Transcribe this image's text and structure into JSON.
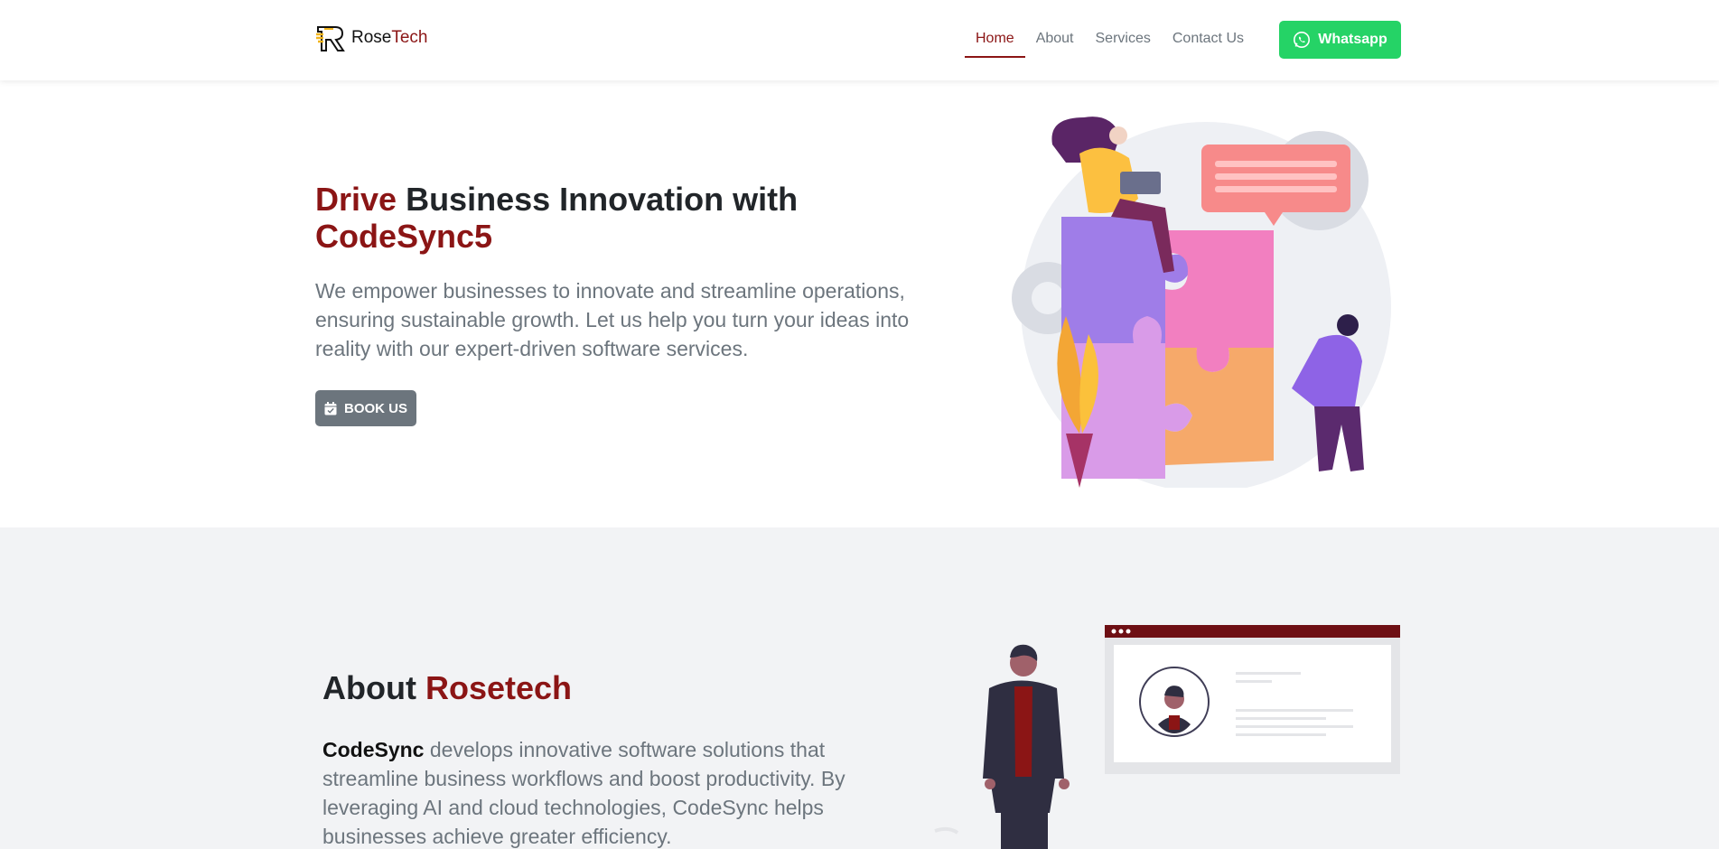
{
  "navbar": {
    "brand": {
      "name_part1": "Rose",
      "name_part2": "Tech",
      "logo_icon": "rosetech-logo-icon"
    },
    "links": [
      {
        "label": "Home",
        "active": true
      },
      {
        "label": "About",
        "active": false
      },
      {
        "label": "Services",
        "active": false
      },
      {
        "label": "Contact Us",
        "active": false
      }
    ],
    "whatsapp": {
      "label": "Whatsapp",
      "icon": "whatsapp-icon"
    }
  },
  "hero": {
    "title_accent": "Drive",
    "title_rest": " Business Innovation with",
    "title_line2": "CodeSync5",
    "description": "We empower businesses to innovate and streamline operations, ensuring sustainable growth. Let us help you turn your ideas into reality with our expert-driven software services.",
    "book_button": {
      "label": "BOOK US",
      "icon": "calendar-check-icon"
    }
  },
  "about": {
    "title_part1": "About ",
    "title_accent": "Rosetech",
    "desc_strong": "CodeSync",
    "desc_rest": " develops innovative software solutions that streamline business workflows and boost productivity. By leveraging AI and cloud technologies, CodeSync helps businesses achieve greater efficiency."
  },
  "colors": {
    "brand": "#8b1515",
    "whatsapp": "#25d366",
    "muted": "#6c757d",
    "section_bg": "#f2f3f5"
  }
}
